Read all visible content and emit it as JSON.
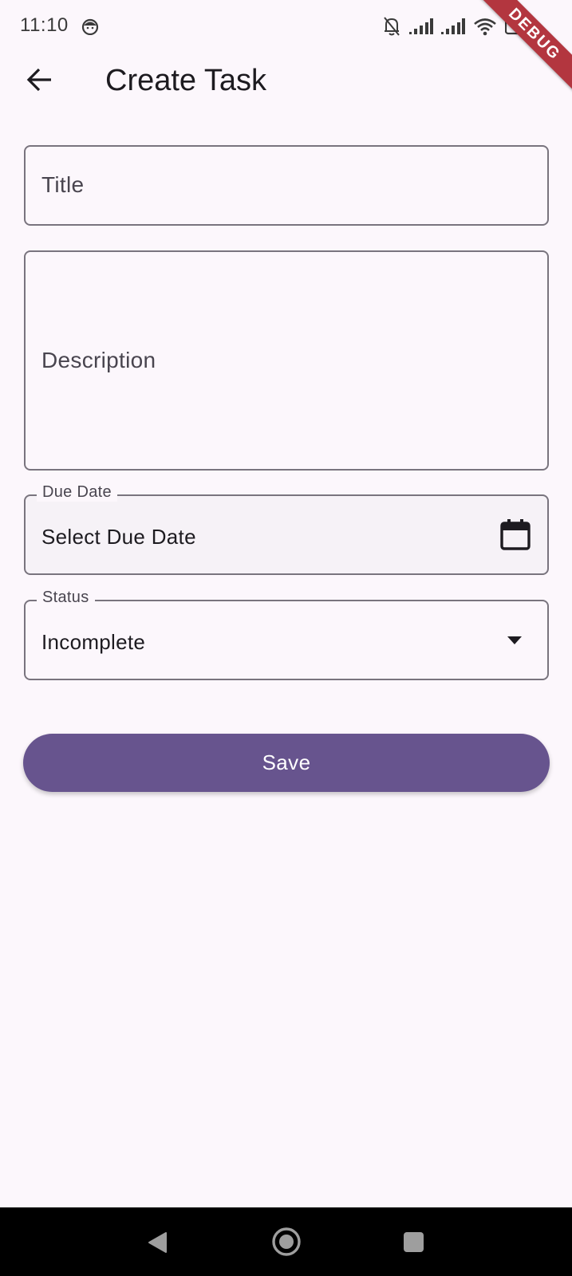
{
  "status_bar": {
    "time": "11:10",
    "icons": [
      "face-icon",
      "bell-off-icon",
      "signal-icon",
      "signal-icon",
      "wifi-icon",
      "battery-charging-icon"
    ]
  },
  "debug_banner": "DEBUG",
  "app_bar": {
    "back_icon": "arrow-left-icon",
    "title": "Create Task"
  },
  "form": {
    "title_field": {
      "placeholder": "Title",
      "value": ""
    },
    "description_field": {
      "placeholder": "Description",
      "value": ""
    },
    "due_date_field": {
      "label": "Due Date",
      "value": "Select Due Date",
      "icon": "calendar-icon"
    },
    "status_field": {
      "label": "Status",
      "value": "Incomplete",
      "icon": "dropdown-arrow-icon"
    },
    "save_label": "Save"
  },
  "nav_bar": {
    "icons": [
      "nav-back-icon",
      "nav-home-icon",
      "nav-recents-icon"
    ]
  },
  "colors": {
    "background": "#fcf7fc",
    "primary": "#67548e",
    "outline": "#79747e",
    "debug_ribbon": "#b3363f"
  }
}
